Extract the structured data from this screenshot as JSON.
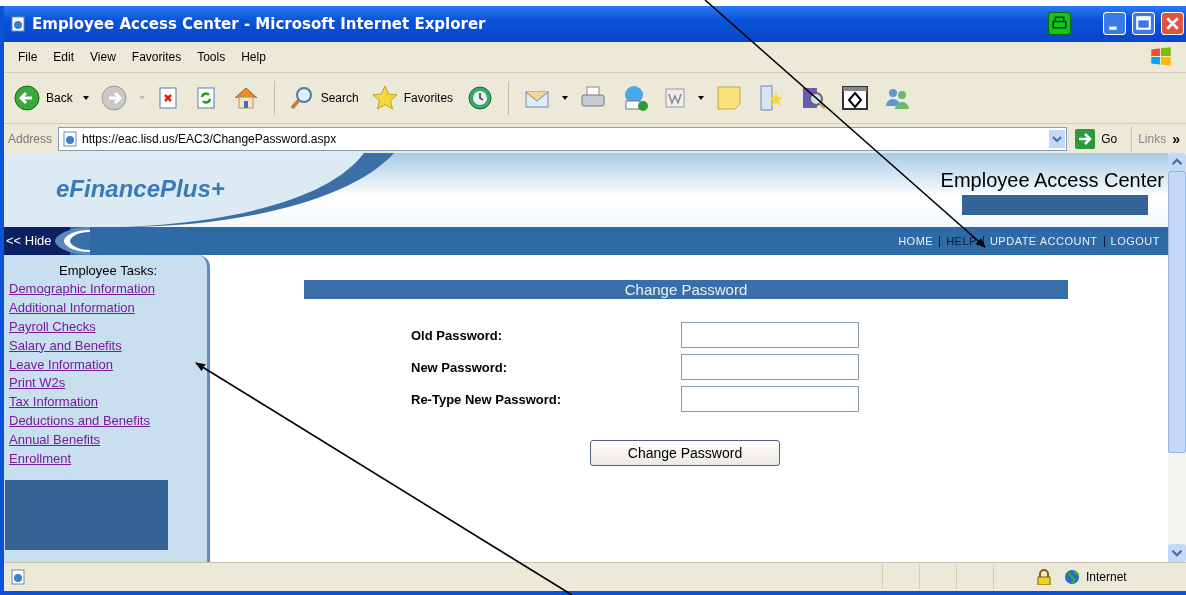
{
  "window": {
    "title": "Employee Access Center - Microsoft Internet Explorer"
  },
  "menu": [
    "File",
    "Edit",
    "View",
    "Favorites",
    "Tools",
    "Help"
  ],
  "toolbar": [
    {
      "label": "Back"
    },
    {
      "label": "Search"
    },
    {
      "label": "Favorites"
    }
  ],
  "address_bar": {
    "label": "Address",
    "url": "https://eac.lisd.us/EAC3/ChangePassword.aspx",
    "go": "Go",
    "links": "Links",
    "more": "»"
  },
  "page": {
    "logo": "eFinancePlus+",
    "header_title": "Employee Access Center",
    "hide": "<< Hide",
    "nav": [
      {
        "label": "HOME",
        "selected": false
      },
      {
        "label": "HELP",
        "selected": true
      },
      {
        "label": "UPDATE ACCOUNT",
        "selected": false
      },
      {
        "label": "LOGOUT",
        "selected": false
      }
    ],
    "sidebar": {
      "heading": "Employee Tasks:",
      "links": [
        "Demographic Information",
        "Additional Information",
        "Payroll Checks",
        "Salary and Benefits",
        "Leave Information",
        "Print W2s",
        "Tax Information",
        "Deductions and Benefits",
        "Annual Benefits",
        "Enrollment"
      ]
    },
    "form": {
      "title": "Change Password",
      "fields": [
        {
          "label": "Old Password:"
        },
        {
          "label": "New Password:"
        },
        {
          "label": "Re-Type New Password:"
        }
      ],
      "button": "Change Password"
    }
  },
  "status_bar": {
    "zone": "Internet"
  }
}
